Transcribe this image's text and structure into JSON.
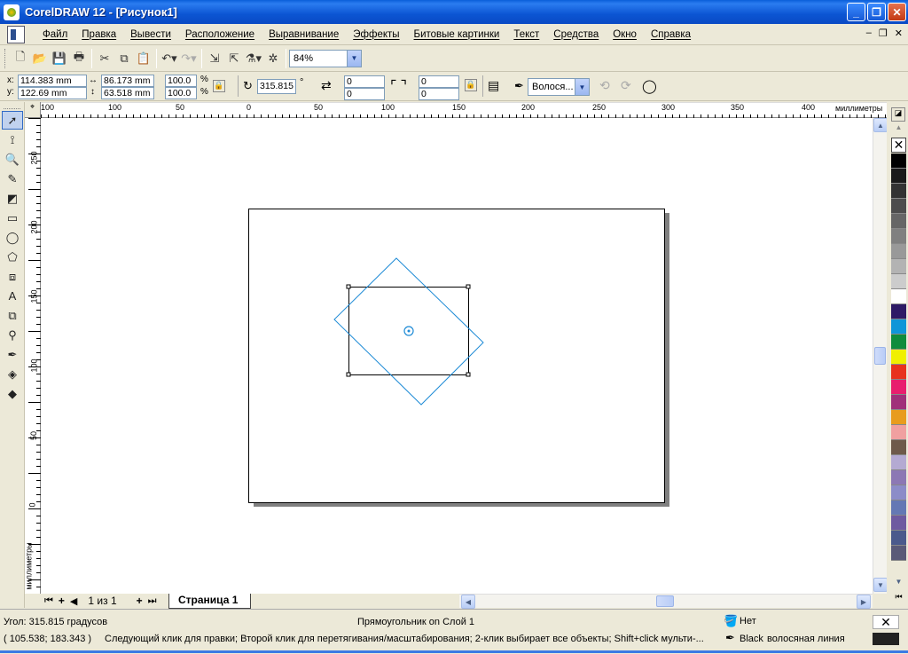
{
  "window": {
    "title": "CorelDRAW 12 - [Рисунок1]",
    "min": "_",
    "max": "❐",
    "close": "✕"
  },
  "menu": [
    "Файл",
    "Правка",
    "Вывести",
    "Расположение",
    "Выравнивание",
    "Эффекты",
    "Битовые картинки",
    "Текст",
    "Средства",
    "Окно",
    "Справка"
  ],
  "mdi": {
    "min": "–",
    "restore": "❐",
    "close": "✕"
  },
  "toolbar": {
    "zoom": "84%"
  },
  "propbar": {
    "x_label": "x:",
    "x_value": "114.383 mm",
    "y_label": "y:",
    "y_value": "122.69 mm",
    "width_value": "86.173 mm",
    "height_value": "63.518 mm",
    "scale_w": "100.0",
    "scale_h": "100.0",
    "pct": "%",
    "angle": "315.815",
    "deg": "°",
    "corner1": "0",
    "corner2": "0",
    "corner3": "0",
    "corner4": "0",
    "outline": "Волося..."
  },
  "rulers": {
    "units": "миллиметры",
    "h_ticks": [
      "100",
      "50",
      "0",
      "50",
      "100",
      "150",
      "200",
      "250",
      "300",
      "350",
      "400"
    ],
    "v_ticks": [
      "250",
      "200",
      "150",
      "100",
      "50",
      "0"
    ],
    "v_units": "миллиметры"
  },
  "pagenav": {
    "counter": "1 из 1",
    "tab": "Страница 1"
  },
  "status": {
    "angle": "Угол: 315.815 градусов",
    "object": "Прямоугольник on Слой 1",
    "fill": "Нет",
    "coords": "( 105.538; 183.343 )",
    "hint": "Следующий клик для правки; Второй клик для перетягивания/масштабирования; 2-клик выбирает все объекты; Shift+click мульти-...",
    "outline_color": "Black",
    "outline_type": "волосяная линия"
  },
  "colors": {
    "accent": "#0a5fd9",
    "selection": "#1e8bd6",
    "palette": [
      "#000000",
      "#1a1a1a",
      "#333333",
      "#4d4d4d",
      "#666666",
      "#808080",
      "#999999",
      "#b3b3b3",
      "#cccccc",
      "#ffffff",
      "#2e1a66",
      "#0f96d8",
      "#0f8c3c",
      "#f0f000",
      "#e8321e",
      "#e81e6e",
      "#a0307a",
      "#e89c1e",
      "#f0a0a0",
      "#6e5a4a",
      "#b4aad2",
      "#8c78b4",
      "#8c8cc8",
      "#6478b4",
      "#6e5aa0",
      "#4b5a8c",
      "#5a5a78"
    ]
  }
}
